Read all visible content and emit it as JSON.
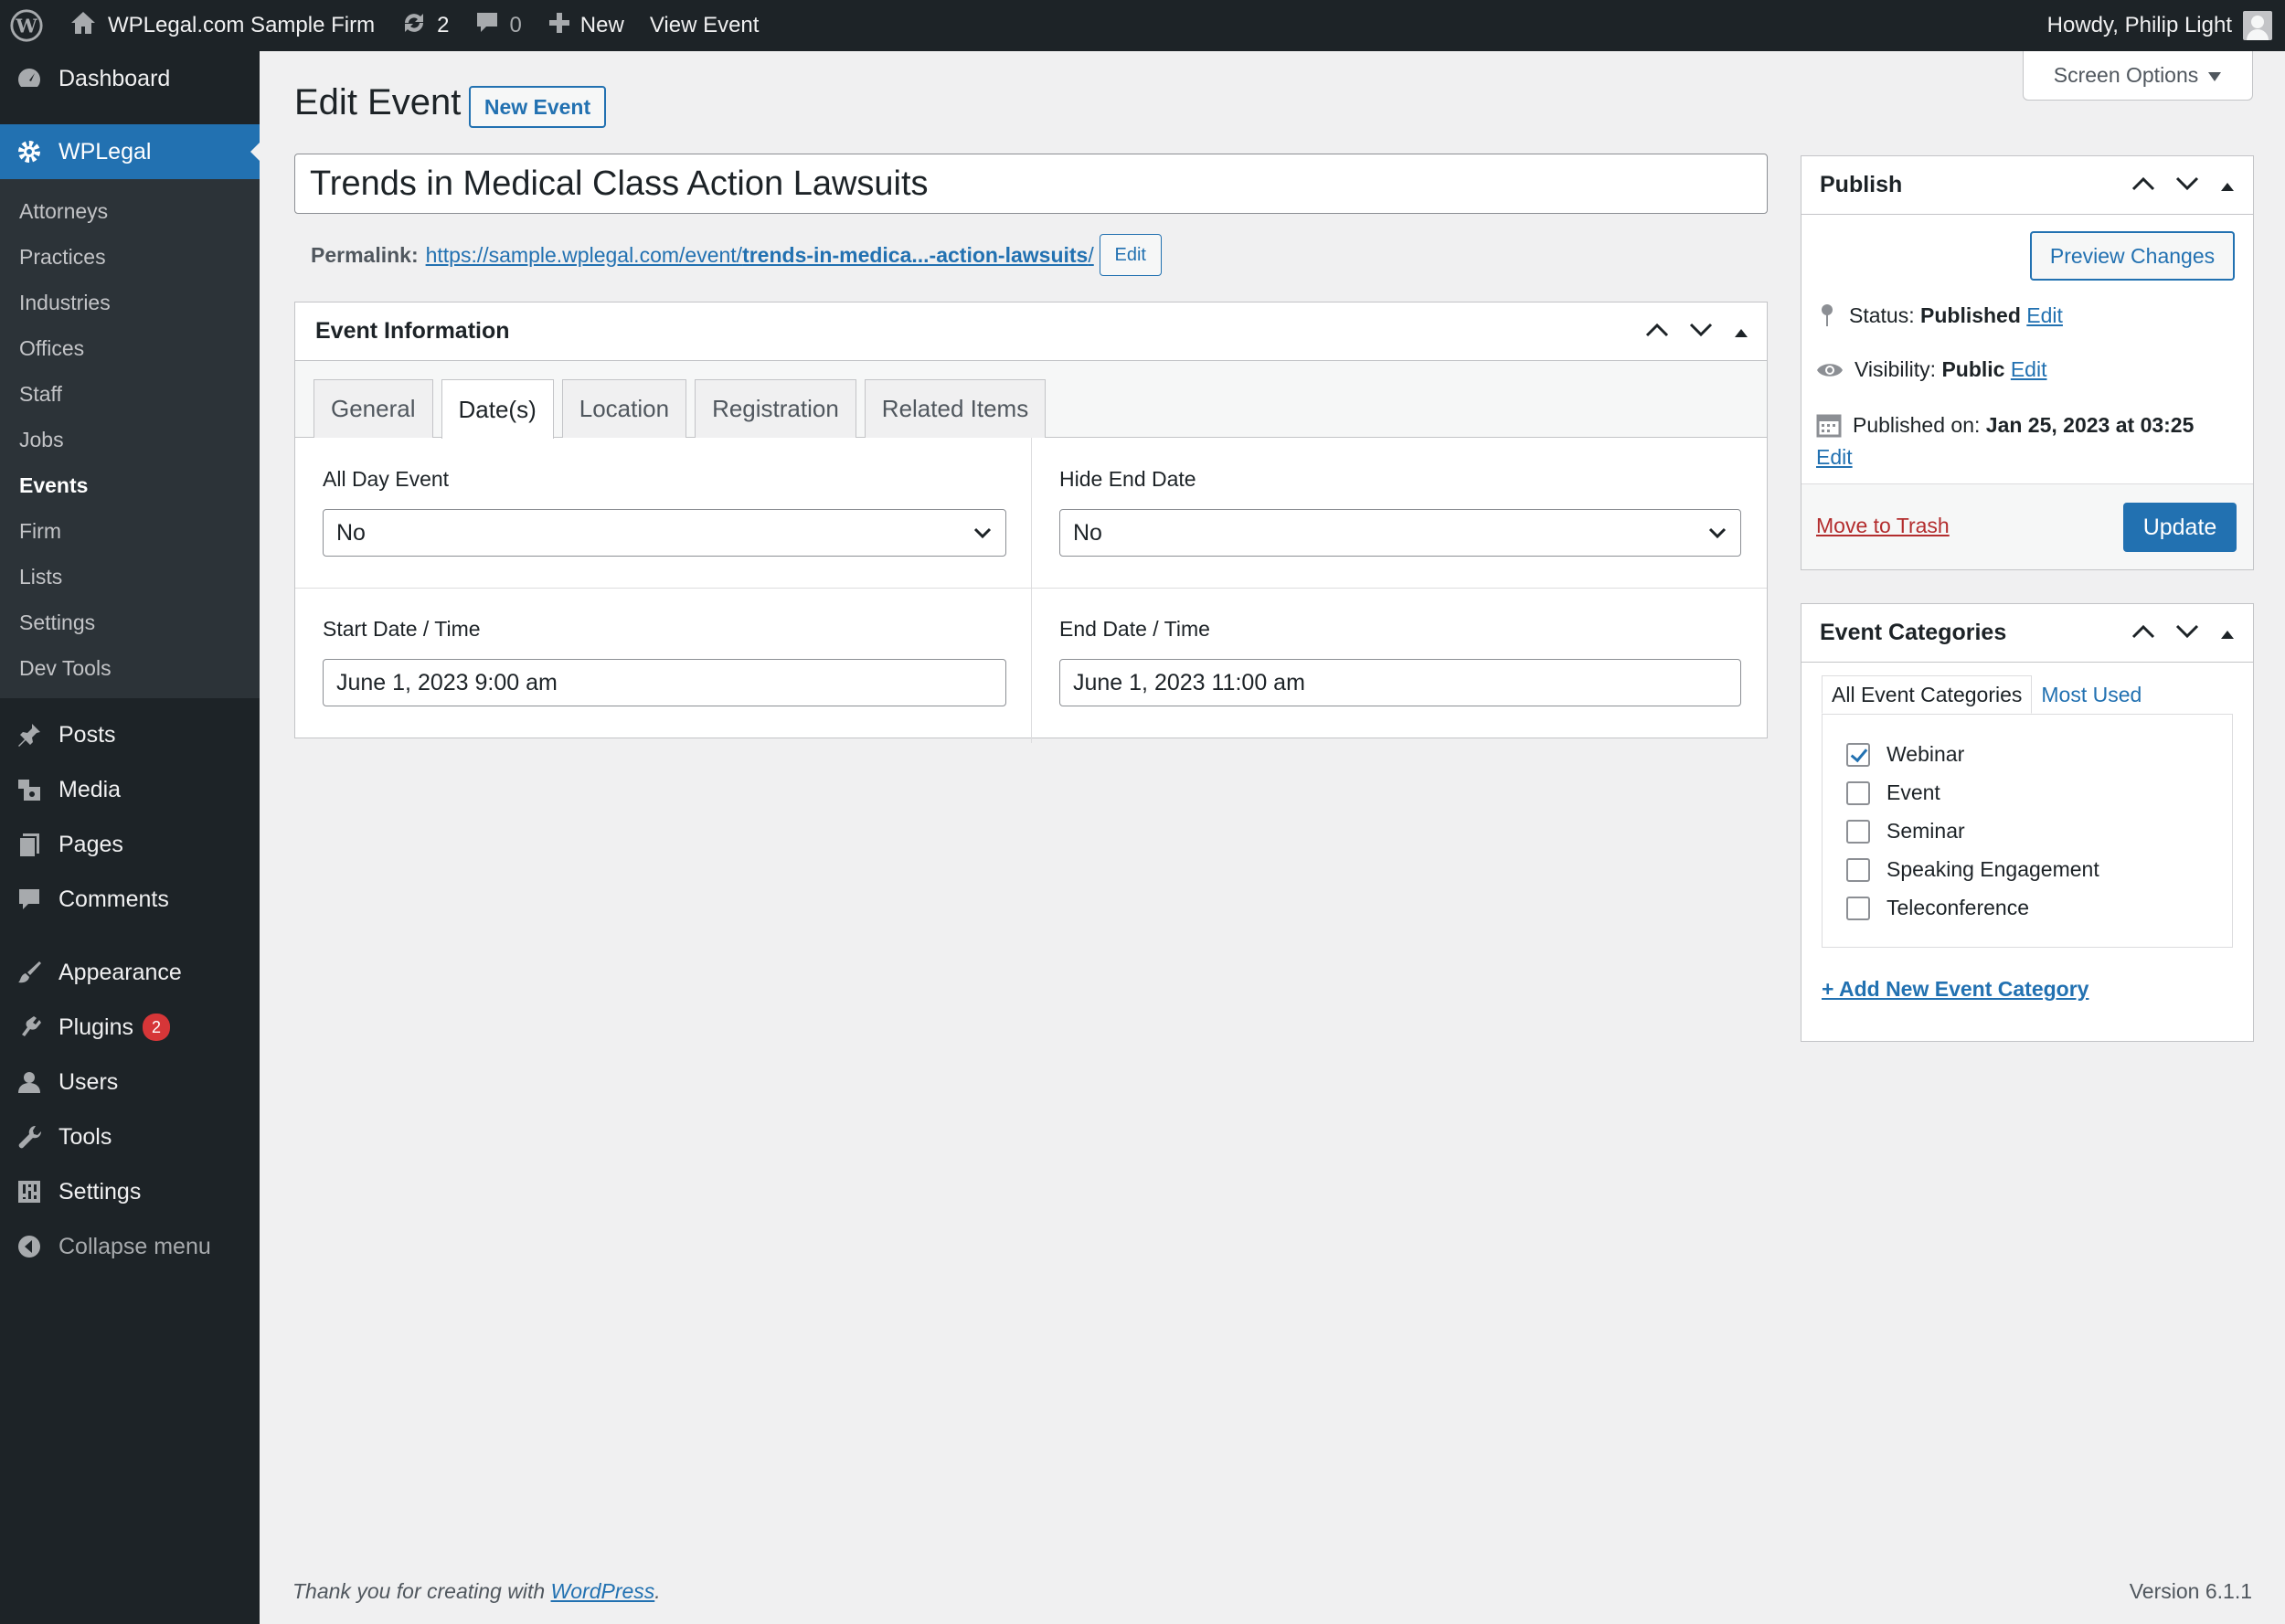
{
  "admin_bar": {
    "site_name": "WPLegal.com Sample Firm",
    "updates_count": "2",
    "comments_count": "0",
    "new_label": "New",
    "view_label": "View Event",
    "greeting": "Howdy, Philip Light"
  },
  "sidebar": {
    "dashboard": "Dashboard",
    "wplegal": "WPLegal",
    "submenu": [
      "Attorneys",
      "Practices",
      "Industries",
      "Offices",
      "Staff",
      "Jobs",
      "Events",
      "Firm",
      "Lists",
      "Settings",
      "Dev Tools"
    ],
    "current_sub": "Events",
    "posts": "Posts",
    "media": "Media",
    "pages": "Pages",
    "comments": "Comments",
    "appearance": "Appearance",
    "plugins": "Plugins",
    "plugins_badge": "2",
    "users": "Users",
    "tools": "Tools",
    "settings": "Settings",
    "collapse": "Collapse menu"
  },
  "header": {
    "screen_options": "Screen Options",
    "title": "Edit Event",
    "new_button": "New Event"
  },
  "post": {
    "title_value": "Trends in Medical Class Action Lawsuits",
    "permalink_label": "Permalink:",
    "permalink_base": "https://sample.wplegal.com/event/",
    "permalink_slug": "trends-in-medica...-action-lawsuits",
    "permalink_tail": "/",
    "permalink_edit": "Edit"
  },
  "event_info": {
    "title": "Event Information",
    "tabs": [
      "General",
      "Date(s)",
      "Location",
      "Registration",
      "Related Items"
    ],
    "active_tab": "Date(s)",
    "all_day_label": "All Day Event",
    "all_day_value": "No",
    "hide_end_label": "Hide End Date",
    "hide_end_value": "No",
    "start_label": "Start Date / Time",
    "start_value": "June 1, 2023 9:00 am",
    "end_label": "End Date / Time",
    "end_value": "June 1, 2023 11:00 am"
  },
  "publish": {
    "title": "Publish",
    "preview": "Preview Changes",
    "status_label": "Status:",
    "status_value": "Published",
    "visibility_label": "Visibility:",
    "visibility_value": "Public",
    "published_label": "Published on:",
    "published_value": "Jan 25, 2023 at 03:25",
    "edit": "Edit",
    "trash": "Move to Trash",
    "update": "Update"
  },
  "categories": {
    "title": "Event Categories",
    "tab_all": "All Event Categories",
    "tab_used": "Most Used",
    "items": [
      {
        "label": "Webinar",
        "checked": true
      },
      {
        "label": "Event",
        "checked": false
      },
      {
        "label": "Seminar",
        "checked": false
      },
      {
        "label": "Speaking Engagement",
        "checked": false
      },
      {
        "label": "Teleconference",
        "checked": false
      }
    ],
    "add_new": "+ Add New Event Category"
  },
  "footer": {
    "thanks_prefix": "Thank you for creating with ",
    "thanks_link": "WordPress",
    "thanks_suffix": ".",
    "version": "Version 6.1.1"
  },
  "colors": {
    "admin_bg": "#1d2327",
    "accent": "#2271b1",
    "danger": "#b32d2e"
  }
}
